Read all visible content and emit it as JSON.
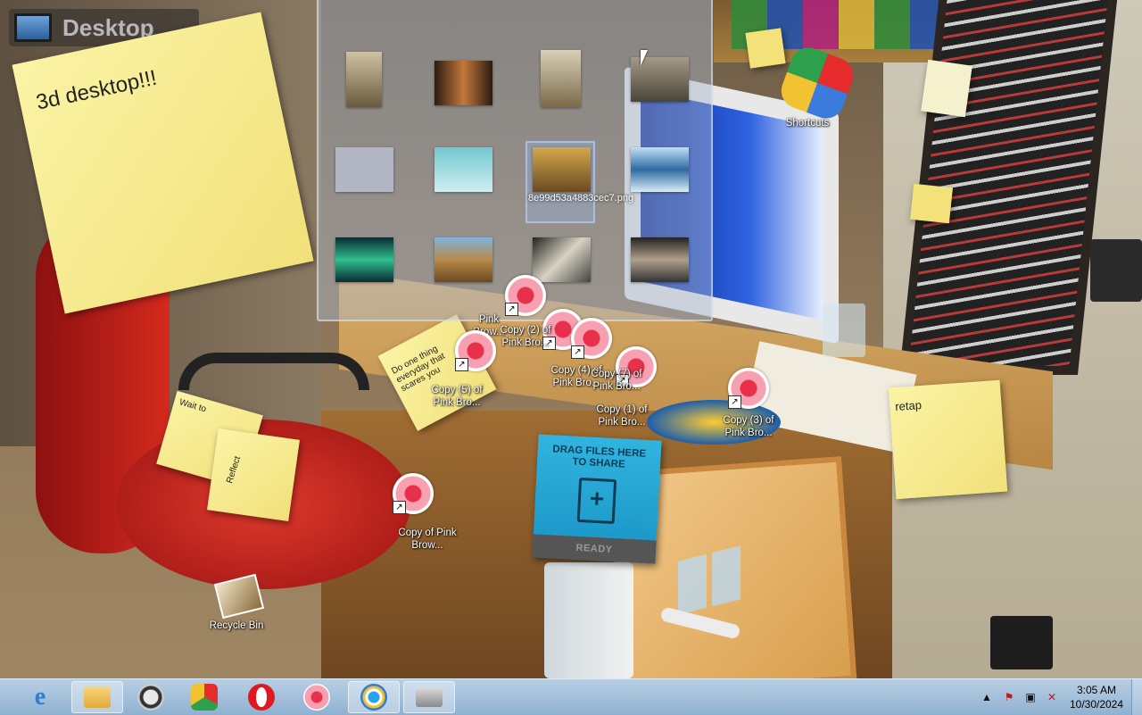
{
  "desktop_label": "Desktop",
  "notes": {
    "big": "3d desktop!!!",
    "small1": "Do one thing everyday that scares you",
    "small2": "Wait to",
    "small3": "Reflect",
    "right": "retap"
  },
  "stack": {
    "selected_label": "8e99d53a4883cec7.png"
  },
  "icons": {
    "shortcuts": "Shortcuts",
    "recycle_bin": "Recycle Bin",
    "pink": "Pink Brow...",
    "copy2": "Copy (2) of Pink Bro...",
    "copy5": "Copy (5) of Pink Bro...",
    "copy4": "Copy (4) of Pink Bro...",
    "copy7": "Copy (7) of Pink Bro...",
    "copy1": "Copy (1) of Pink Bro...",
    "copy3": "Copy (3) of Pink Bro...",
    "copy": "Copy of Pink Brow..."
  },
  "share": {
    "title": "DRAG FILES HERE TO SHARE",
    "status": "READY"
  },
  "taskbar": {
    "apps": [
      "internet-explorer",
      "file-explorer",
      "media-player",
      "app-store",
      "opera",
      "pink-rose",
      "camera",
      "scanner"
    ],
    "clock_time": "3:05 AM",
    "clock_date": "10/30/2024"
  },
  "colors": {
    "taskbar": "#a6c2dd",
    "sticky": "#f6ec96",
    "share": "#2aa7d5"
  }
}
